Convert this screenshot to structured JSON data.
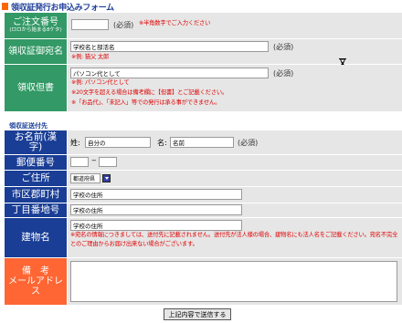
{
  "title": "領収証発行お申込みフォーム",
  "colors": {
    "green": "#339966",
    "blue": "#1a3e96",
    "orange": "#ff6633",
    "note": "#e00000"
  },
  "order_number": {
    "label": "ご注文番号",
    "sublabel": "(ロロから始まる8ケタ)",
    "value": "",
    "required": "(必須)",
    "note": "※半角数字でご入力ください"
  },
  "receipt_name": {
    "label": "領収証御宛名",
    "value": "学校名と部活名",
    "required": "(必須)",
    "note": "※例: 猫父 太郎"
  },
  "receipt_description": {
    "label": "領収但書",
    "value": "パソコン代として",
    "required": "(必須)",
    "notes": [
      "※例: パソコン代として",
      "※20文字を超える場合は備考欄に【但書】とご記載ください。",
      "※「お品代」、「未記入」等での発行は承る事ができません。"
    ]
  },
  "section_heading": "領収証送付先",
  "name": {
    "label": "お名前(漢字)",
    "last_label": "姓:",
    "last_value": "自分の",
    "first_label": "名:",
    "first_value": "名前",
    "required": "(必須)"
  },
  "postal": {
    "label": "郵便番号",
    "part1": "",
    "separator": "−",
    "part2": ""
  },
  "address": {
    "label": "ご住所",
    "prefecture": "都道府県"
  },
  "city": {
    "label": "市区郡町村",
    "value": "学校の住所"
  },
  "street": {
    "label": "丁目番地号",
    "value": "学校の住所"
  },
  "building": {
    "label": "建物名",
    "value": "学校の住所",
    "note": "※宛名の情報につきましては、送付先に記載されません。送付先が法人様の場合、建物名にも法人名をご記載ください。宛名不完全とのご理由からお届け出来ない場合がございます。"
  },
  "remarks": {
    "label1": "備　考",
    "label2": "メールアドレス",
    "value": ""
  },
  "submit_label": "上記内容で送信する"
}
